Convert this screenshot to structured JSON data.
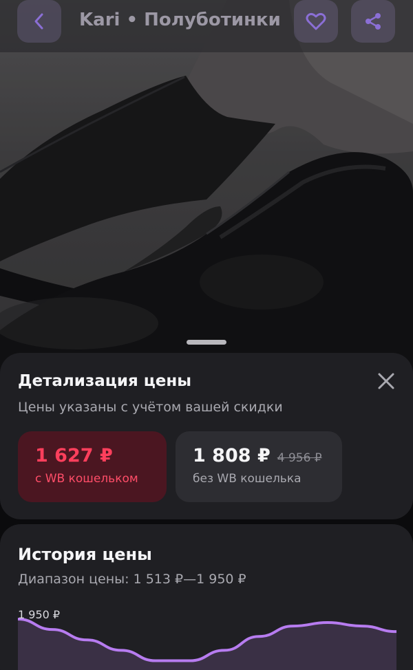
{
  "header": {
    "title": "Kari • Полуботинки ...",
    "back_icon": "chevron-left-icon",
    "favorite_icon": "heart-icon",
    "share_icon": "share-icon"
  },
  "price_details": {
    "title": "Детализация цены",
    "subtitle": "Цены указаны с учётом вашей скидки",
    "close_icon": "close-icon",
    "with_wallet": {
      "price": "1 627 ₽",
      "note": "с WB кошельком",
      "color": "#ff3f5c"
    },
    "without_wallet": {
      "price": "1 808 ₽",
      "old_price": "4 956 ₽",
      "note": "без WB кошелька"
    }
  },
  "price_history": {
    "title": "История цены",
    "range_label": "Диапазон цены: 1 513 ₽—1 950 ₽",
    "y_max_label": "1 950 ₽",
    "line_color": "#b77cf0"
  },
  "chart_data": {
    "type": "area",
    "y_max_label": "1 950 ₽",
    "values": [
      1950,
      1935,
      1920,
      1905,
      1890,
      1890,
      1905,
      1925,
      1940,
      1945,
      1940,
      1932
    ]
  }
}
